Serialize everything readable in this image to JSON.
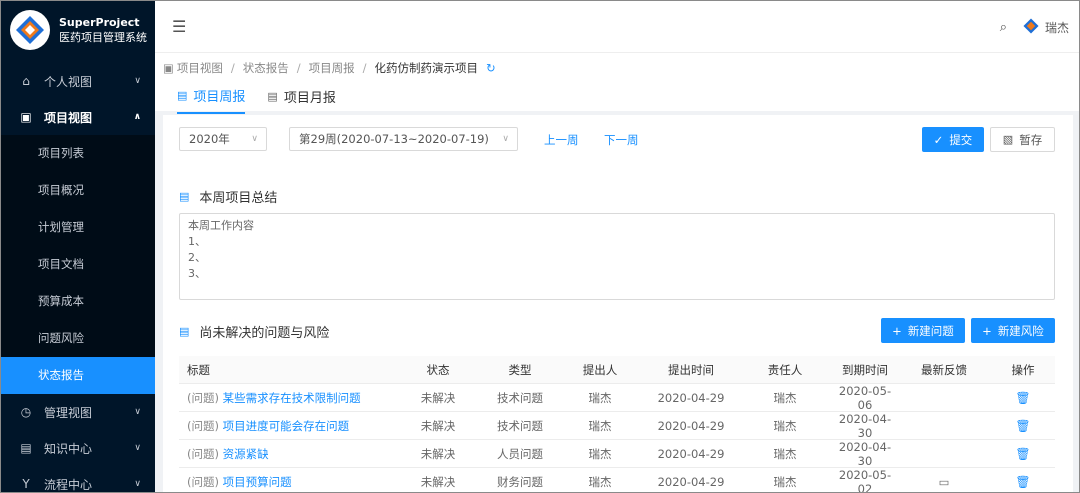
{
  "brand": {
    "name": "SuperProject",
    "subtitle": "医药项目管理系统"
  },
  "sidebar": {
    "groups": [
      {
        "label": "个人视图",
        "icon": "home-icon"
      },
      {
        "label": "项目视图",
        "icon": "project-icon"
      },
      {
        "label": "管理视图",
        "icon": "dashboard-icon"
      },
      {
        "label": "知识中心",
        "icon": "knowledge-icon"
      },
      {
        "label": "流程中心",
        "icon": "process-icon"
      }
    ],
    "sub_items": [
      "项目列表",
      "项目概况",
      "计划管理",
      "项目文档",
      "预算成本",
      "问题风险",
      "状态报告"
    ]
  },
  "header": {
    "user": "瑞杰"
  },
  "breadcrumb": [
    "项目视图",
    "状态报告",
    "项目周报",
    "化药仿制药演示项目"
  ],
  "tabs": [
    "项目周报",
    "项目月报"
  ],
  "toolbar": {
    "year": "2020年",
    "week": "第29周(2020-07-13~2020-07-19)",
    "prev": "上一周",
    "next": "下一周",
    "submit": "提交",
    "draft": "暂存"
  },
  "summary": {
    "title": "本周项目总结",
    "content": "本周工作内容\n1、\n2、\n3、"
  },
  "issues": {
    "title": "尚未解决的问题与风险",
    "new_issue": "新建问题",
    "new_risk": "新建风险",
    "columns": [
      "标题",
      "状态",
      "类型",
      "提出人",
      "提出时间",
      "责任人",
      "到期时间",
      "最新反馈",
      "操作"
    ],
    "rows": [
      {
        "tag": "(问题)",
        "title": "某些需求存在技术限制问题",
        "status": "未解决",
        "type": "技术问题",
        "submitter": "瑞杰",
        "time": "2020-04-29",
        "owner": "瑞杰",
        "due": "2020-05-06"
      },
      {
        "tag": "(问题)",
        "title": "项目进度可能会存在问题",
        "status": "未解决",
        "type": "技术问题",
        "submitter": "瑞杰",
        "time": "2020-04-29",
        "owner": "瑞杰",
        "due": "2020-04-30"
      },
      {
        "tag": "(问题)",
        "title": "资源紧缺",
        "status": "未解决",
        "type": "人员问题",
        "submitter": "瑞杰",
        "time": "2020-04-29",
        "owner": "瑞杰",
        "due": "2020-04-30"
      },
      {
        "tag": "(问题)",
        "title": "项目预算问题",
        "status": "未解决",
        "type": "财务问题",
        "submitter": "瑞杰",
        "time": "2020-04-29",
        "owner": "瑞杰",
        "due": "2020-05-02"
      }
    ]
  },
  "colors": {
    "primary": "#1890ff",
    "sidebar": "#001529"
  }
}
